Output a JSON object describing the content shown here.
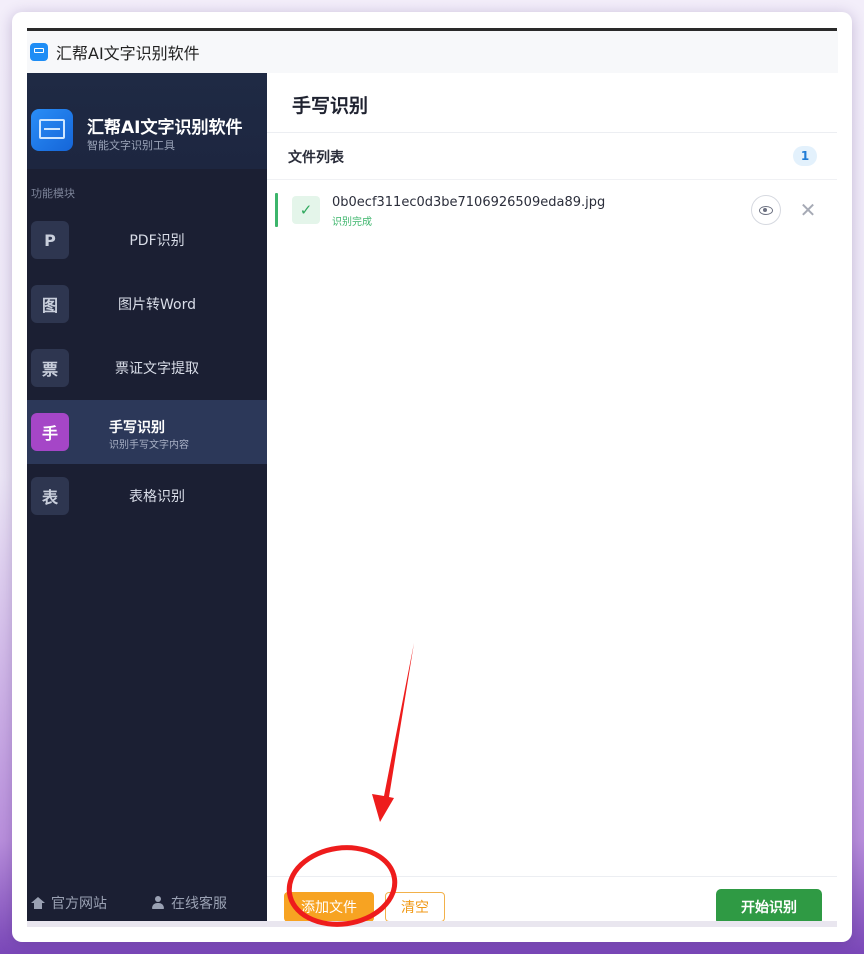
{
  "window": {
    "title": "汇帮AI文字识别软件"
  },
  "sidebar": {
    "brand_name": "汇帮AI文字识别软件",
    "brand_sub": "智能文字识别工具",
    "section_label": "功能模块",
    "items": [
      {
        "badge": "P",
        "label": "PDF识别"
      },
      {
        "badge": "图",
        "label": "图片转Word"
      },
      {
        "badge": "票",
        "label": "票证文字提取"
      },
      {
        "badge": "手",
        "label": "手写识别",
        "sub": "识别手写文字内容",
        "active": true
      },
      {
        "badge": "表",
        "label": "表格识别"
      }
    ],
    "footer": {
      "website": "官方网站",
      "support": "在线客服"
    }
  },
  "main": {
    "title": "手写识别",
    "file_list_label": "文件列表",
    "file_count": "1",
    "files": [
      {
        "name": "0b0ecf311ec0d3be7106926509eda89.jpg",
        "status": "识别完成"
      }
    ],
    "buttons": {
      "add": "添加文件",
      "clear": "清空",
      "start": "开始识别"
    }
  },
  "colors": {
    "accent_green": "#2f9a44",
    "accent_orange": "#f7a322",
    "active_badge": "#a546c7",
    "sidebar_bg": "#1b1f33",
    "annotation_red": "#ee1c1c"
  },
  "icons": [
    "app-icon",
    "brand-logo-icon",
    "check-icon",
    "eye-icon",
    "close-icon",
    "home-icon",
    "person-icon"
  ]
}
